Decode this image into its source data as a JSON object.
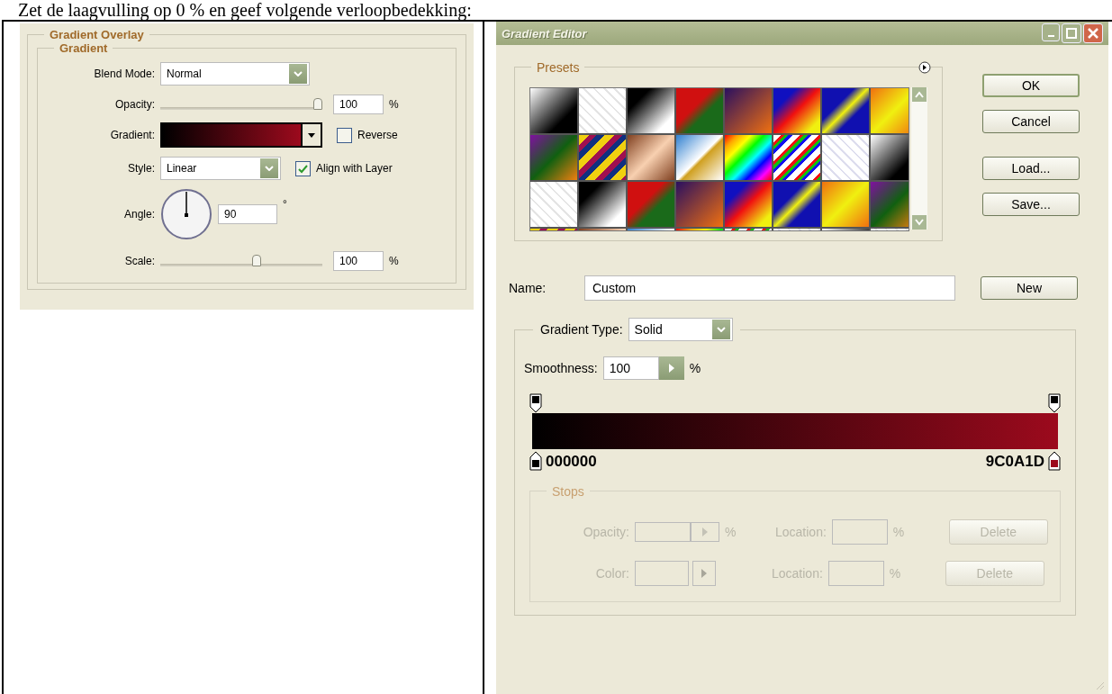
{
  "caption": "Zet de laagvulling op 0 % en geef volgende verloopbedekking:",
  "layer_style": {
    "title": "Gradient Overlay",
    "group": "Gradient",
    "blend_mode": {
      "label": "Blend Mode:",
      "value": "Normal"
    },
    "opacity": {
      "label": "Opacity:",
      "level": 1,
      "value": "100",
      "unit": "%"
    },
    "gradient": {
      "label": "Gradient:"
    },
    "reverse": {
      "label": "Reverse",
      "checked": false
    },
    "style": {
      "label": "Style:",
      "value": "Linear"
    },
    "align": {
      "label": "Align with Layer",
      "checked": true
    },
    "angle": {
      "label": "Angle:",
      "value": "90",
      "unit": "°"
    },
    "scale": {
      "label": "Scale:",
      "level": 0.6,
      "value": "100",
      "unit": "%"
    }
  },
  "gradient_editor": {
    "title": "Gradient Editor",
    "presets_label": "Presets",
    "buttons": [
      {
        "label": "OK",
        "selected": true
      },
      {
        "label": "Cancel",
        "selected": false
      },
      {
        "label": "Load...",
        "selected": false
      },
      {
        "label": "Save...",
        "selected": false
      }
    ],
    "name": {
      "label": "Name:",
      "value": "Custom"
    },
    "new_button": "New",
    "gradient_type": {
      "label": "Gradient Type:",
      "value": "Solid"
    },
    "smoothness": {
      "label": "Smoothness:",
      "value": "100",
      "unit": "%"
    },
    "color_stops": [
      {
        "hex": "000000",
        "color": "#000000"
      },
      {
        "hex": "9C0A1D",
        "color": "#9c0a1d"
      }
    ],
    "stops": {
      "title": "Stops",
      "disabled": true,
      "rows": [
        {
          "kind": "stepper",
          "label": "Opacity:",
          "unit": "%",
          "location_label": "Location:",
          "location_unit": "%",
          "button": "Delete"
        },
        {
          "kind": "swatch",
          "label": "Color:",
          "location_label": "Location:",
          "location_unit": "%",
          "button": "Delete"
        }
      ]
    }
  }
}
